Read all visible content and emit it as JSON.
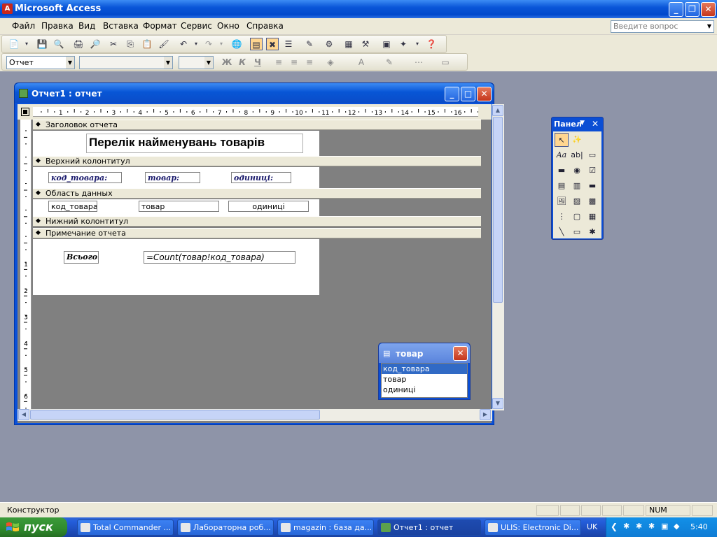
{
  "app": {
    "title": "Microsoft Access"
  },
  "menu": [
    "Файл",
    "Правка",
    "Вид",
    "Вставка",
    "Формат",
    "Сервис",
    "Окно",
    "Справка"
  ],
  "ask_box": {
    "placeholder": "Введите вопрос"
  },
  "format_toolbar": {
    "object_combo": "Отчет",
    "bold": "Ж",
    "italic": "К",
    "underline": "Ч"
  },
  "report_window": {
    "title": "Отчет1 : отчет"
  },
  "ruler_numbers": [
    "1",
    "2",
    "3",
    "4",
    "5",
    "6",
    "7",
    "8",
    "9",
    "10",
    "11",
    "12",
    "13",
    "14",
    "15",
    "16"
  ],
  "vruler_numbers": [
    "1",
    "2",
    "3",
    "4",
    "5",
    "6"
  ],
  "sections": {
    "report_header": "Заголовок отчета",
    "page_header": "Верхний колонтитул",
    "detail": "Область данных",
    "page_footer": "Нижний колонтитул",
    "report_footer": "Примечание отчета"
  },
  "report_title": "Перелік найменувань товарів",
  "page_header_labels": [
    "код_товара:",
    "товар:",
    "одиниці:"
  ],
  "detail_fields": [
    "код_товара",
    "товар",
    "одиниці"
  ],
  "footer": {
    "label": "Всього:",
    "expression": "=Count(товар!код_товара)"
  },
  "field_list": {
    "title": "товар",
    "fields": [
      "код_товара",
      "товар",
      "одиниці"
    ],
    "selected_index": 0
  },
  "toolbox": {
    "title": "Панел",
    "text_box_glyph": "ab|",
    "label_glyph": "Aa"
  },
  "status": {
    "mode": "Конструктор",
    "num": "NUM"
  },
  "taskbar": {
    "start": "пуск",
    "tasks": [
      "Total Commander ...",
      "Лабораторна роб...",
      "magazin : база да...",
      "Отчет1 : отчет",
      "ULIS: Electronic Di..."
    ],
    "active_task": 3,
    "lang": "UK",
    "clock": "5:40"
  },
  "colors": {
    "xp_blue": "#0a56d8",
    "access_red": "#c8281c",
    "label_navy": "#1a1a6c",
    "selection": "#316ac5",
    "start_green": "#2f8a2c"
  }
}
